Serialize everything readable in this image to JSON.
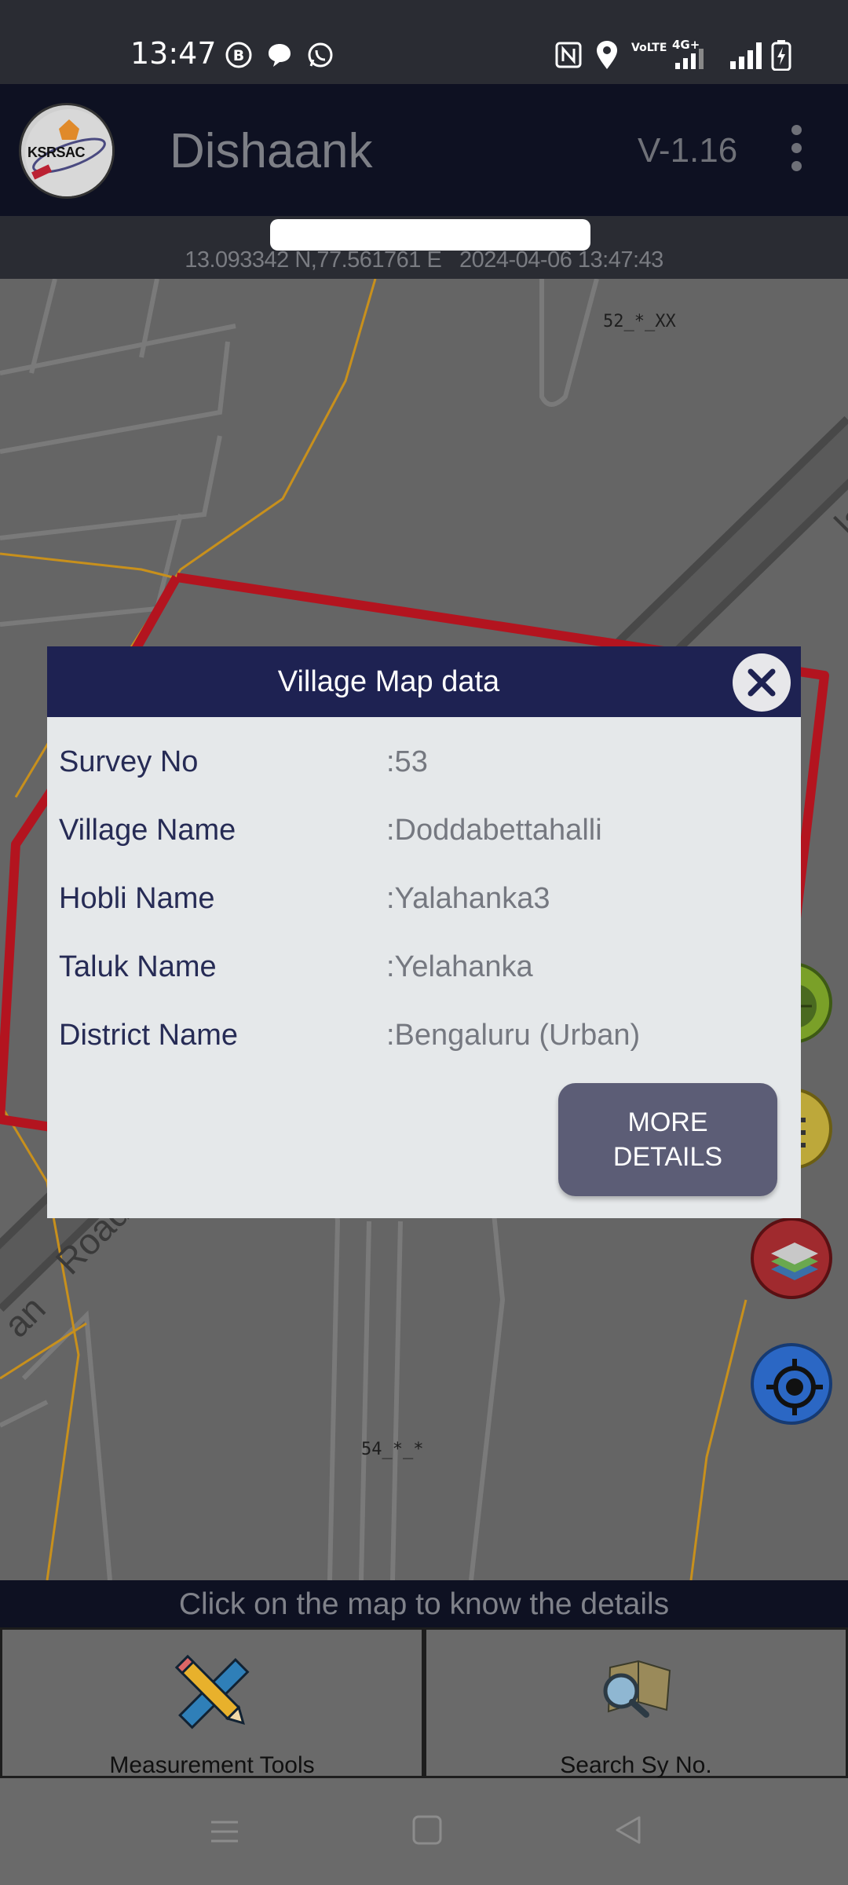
{
  "status_bar": {
    "time": "13:47",
    "left_icons": [
      "b-circle-icon",
      "chat-bubble-icon",
      "whatsapp-icon"
    ],
    "right_icons": [
      "nfc-icon",
      "location-icon",
      "volte-icon",
      "signal-4g-icon",
      "signal-icon",
      "battery-charging-icon"
    ],
    "volte_text": "VoLTE",
    "network_text": "4G+"
  },
  "app_bar": {
    "logo_text": "KSRSAC",
    "title": "Dishaank",
    "version": "V-1.16"
  },
  "location": {
    "coords": "13.093342 N,77.561761 E",
    "timestamp": "2024-04-06 13:47:43"
  },
  "map": {
    "labels": {
      "top": "52_*_XX",
      "bottom": "54_*_*",
      "road": "Road",
      "road_partial": "an",
      "edge": "la"
    }
  },
  "dialog": {
    "title": "Village Map data",
    "rows": [
      {
        "label": "Survey No",
        "value": ":53"
      },
      {
        "label": "Village Name",
        "value": ":Doddabettahalli"
      },
      {
        "label": "Hobli Name",
        "value": ":Yalahanka3"
      },
      {
        "label": "Taluk Name",
        "value": ":Yelahanka"
      },
      {
        "label": "District Name",
        "value": ":Bengaluru (Urban)"
      }
    ],
    "more_button_line1": "MORE",
    "more_button_line2": "DETAILS"
  },
  "hint": "Click on the map to know the details",
  "tools": {
    "measurement_label": "Measurement Tools",
    "search_label": "Search Sy No."
  },
  "colors": {
    "app_bar": "#0e1122",
    "dialog_header": "#1e2252",
    "boundary_red": "#b3141f",
    "road_orange": "#c8901c",
    "location_fab": "#2b67c4"
  }
}
